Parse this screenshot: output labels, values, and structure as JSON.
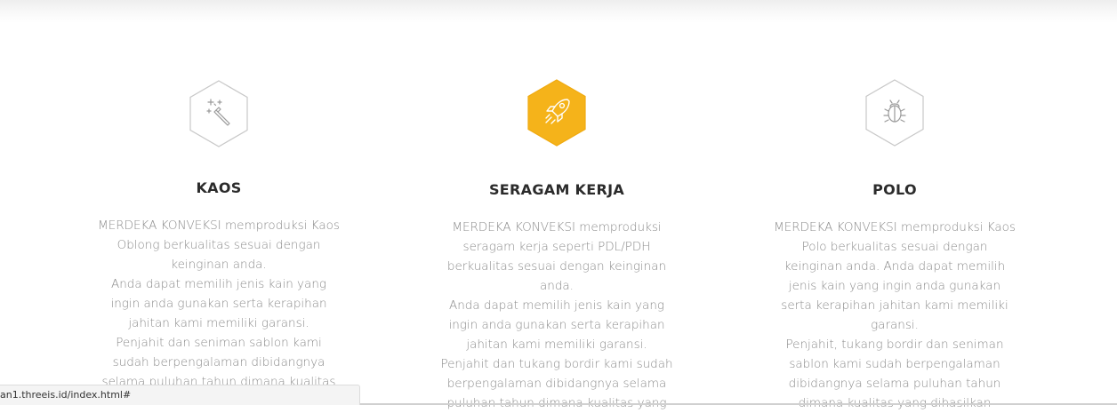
{
  "services": [
    {
      "icon": "magic-wand-icon",
      "title": "KAOS",
      "lines": [
        "MERDEKA KONVEKSI memproduksi Kaos",
        "Oblong berkualitas sesuai dengan",
        "keinginan anda.",
        "Anda dapat memilih jenis kain yang",
        "ingin anda gunakan serta kerapihan",
        "jahitan kami memiliki garansi.",
        "Penjahit dan seniman sablon kami",
        "sudah berpengalaman dibidangnya",
        "selama puluhan tahun dimana kualitas"
      ]
    },
    {
      "icon": "rocket-icon",
      "title": "SERAGAM KERJA",
      "lines": [
        "MERDEKA KONVEKSI memproduksi",
        "seragam kerja seperti PDL/PDH",
        "berkualitas sesuai dengan keinginan",
        "anda.",
        "Anda dapat memilih jenis kain yang",
        "ingin anda gunakan serta kerapihan",
        "jahitan kami memiliki garansi.",
        "Penjahit dan tukang bordir kami sudah",
        "berpengalaman dibidangnya selama",
        "puluhan tahun dimana kualitas yang"
      ]
    },
    {
      "icon": "bug-icon",
      "title": "POLO",
      "lines": [
        "MERDEKA KONVEKSI memproduksi Kaos",
        "Polo berkualitas sesuai dengan",
        "keinginan anda. Anda dapat memilih",
        "jenis kain yang ingin anda gunakan",
        "serta kerapihan jahitan kami memiliki",
        "garansi.",
        "Penjahit, tukang bordir dan seniman",
        "sablon kami sudah berpengalaman",
        "dibidangnya selama puluhan tahun",
        "dimana kualitas yang dihasilkan"
      ]
    }
  ],
  "status_bar": {
    "url": "an1.threeis.id/index.html#"
  },
  "colors": {
    "accent": "#f5b31a",
    "hex_border": "#c8c8c8",
    "title": "#2b2b2b",
    "text": "#8b8b8b"
  }
}
